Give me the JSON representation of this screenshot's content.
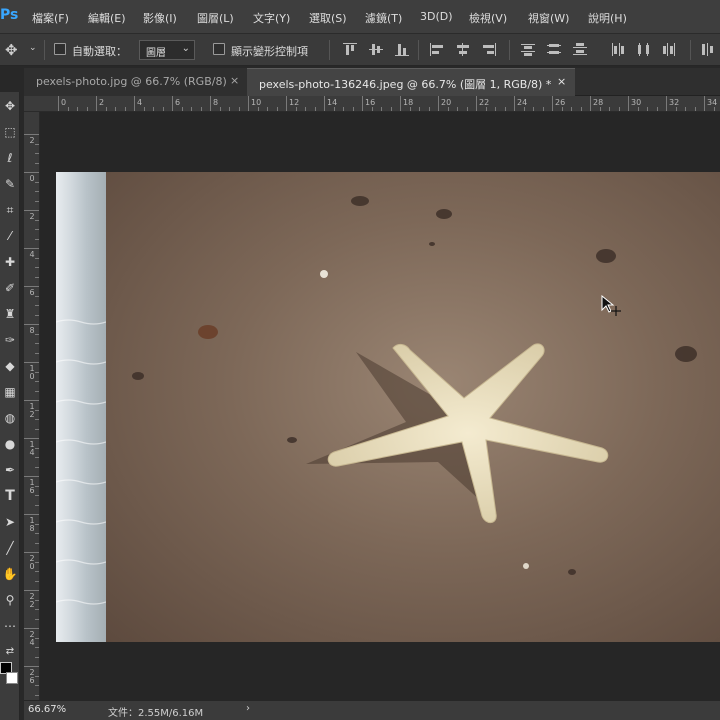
{
  "app": {
    "logo": "Ps"
  },
  "menu": [
    "檔案(F)",
    "編輯(E)",
    "影像(I)",
    "圖層(L)",
    "文字(Y)",
    "選取(S)",
    "濾鏡(T)",
    "3D(D)",
    "檢視(V)",
    "視窗(W)",
    "說明(H)"
  ],
  "options": {
    "auto_select_label": "自動選取：",
    "auto_select_target": "圖層",
    "show_transform_label": "顯示變形控制項"
  },
  "tabs": [
    {
      "label": "pexels-photo.jpg @ 66.7% (RGB/8)",
      "close": "×",
      "active": false
    },
    {
      "label": "pexels-photo-136246.jpeg @ 66.7% (圖層 1, RGB/8) *",
      "close": "×",
      "active": true
    }
  ],
  "ruler": {
    "top": [
      "0",
      "2",
      "4",
      "6",
      "8",
      "10",
      "12",
      "14",
      "16",
      "18",
      "20",
      "22",
      "24",
      "26",
      "28",
      "30",
      "32",
      "34"
    ],
    "left": [
      "2",
      "0",
      "2",
      "4",
      "6",
      "8",
      "10",
      "12",
      "14",
      "16",
      "18",
      "20",
      "22",
      "24",
      "26"
    ]
  },
  "tools": [
    "move-tool-icon",
    "marquee-tool-icon",
    "lasso-tool-icon",
    "quick-select-tool-icon",
    "crop-tool-icon",
    "eyedropper-tool-icon",
    "healing-brush-tool-icon",
    "brush-tool-icon",
    "clone-stamp-tool-icon",
    "history-brush-tool-icon",
    "eraser-tool-icon",
    "gradient-tool-icon",
    "blur-tool-icon",
    "dodge-tool-icon",
    "pen-tool-icon",
    "type-tool-icon",
    "path-select-tool-icon",
    "line-tool-icon",
    "hand-tool-icon",
    "zoom-tool-icon",
    "more-tools-icon"
  ],
  "status": {
    "zoom": "66.67%",
    "doc_info": "文件：2.55M/6.16M",
    "arrow": "›"
  }
}
